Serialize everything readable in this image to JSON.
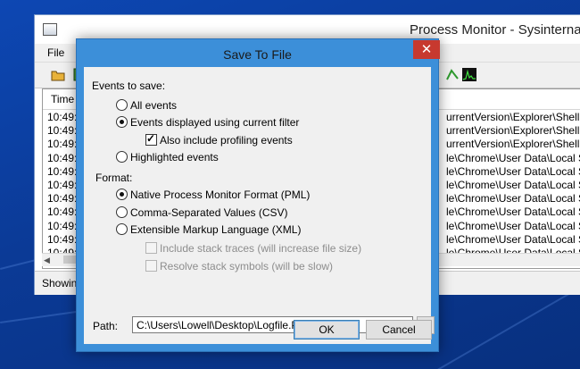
{
  "background_window": {
    "title": "Process Monitor - Sysinternal",
    "menu_first": "File",
    "column_time": "Time ...",
    "status_text": "Showin",
    "rows": [
      {
        "time": "10:49:...",
        "path": "urrentVersion\\Explorer\\Shell Fol"
      },
      {
        "time": "10:49:...",
        "path": "urrentVersion\\Explorer\\Shell Fol"
      },
      {
        "time": "10:49:...",
        "path": "urrentVersion\\Explorer\\Shell Fol"
      },
      {
        "time": "10:49:...",
        "path": "le\\Chrome\\User Data\\Local Sta"
      },
      {
        "time": "10:49:...",
        "path": "le\\Chrome\\User Data\\Local Sta"
      },
      {
        "time": "10:49:...",
        "path": "le\\Chrome\\User Data\\Local Sta"
      },
      {
        "time": "10:49:...",
        "path": "le\\Chrome\\User Data\\Local Sta"
      },
      {
        "time": "10:49:...",
        "path": "le\\Chrome\\User Data\\Local Sta"
      },
      {
        "time": "10:49:...",
        "path": "le\\Chrome\\User Data\\Local Sta"
      },
      {
        "time": "10:49:...",
        "path": "le\\Chrome\\User Data\\Local Sta"
      },
      {
        "time": "10:49:...",
        "path": "le\\Chrome\\User Data\\Local Sta"
      }
    ]
  },
  "dialog": {
    "title": "Save To File",
    "close_glyph": "✕",
    "events_label": "Events to save:",
    "all_events": "All events",
    "displayed_events": "Events displayed using current filter",
    "include_profiling": "Also include profiling events",
    "highlighted_events": "Highlighted events",
    "format_label": "Format:",
    "pml": "Native Process Monitor Format (PML)",
    "csv": "Comma-Separated Values (CSV)",
    "xml": "Extensible Markup Language (XML)",
    "stack_traces": "Include stack traces (will increase file size)",
    "resolve_symbols": "Resolve stack symbols (will be slow)",
    "path_label": "Path:",
    "path_value": "C:\\Users\\Lowell\\Desktop\\Logfile.PML",
    "browse_label": "...",
    "ok_label": "OK",
    "cancel_label": "Cancel",
    "selected_event_option": "displayed_events",
    "selected_format": "pml",
    "include_profiling_checked": true
  }
}
